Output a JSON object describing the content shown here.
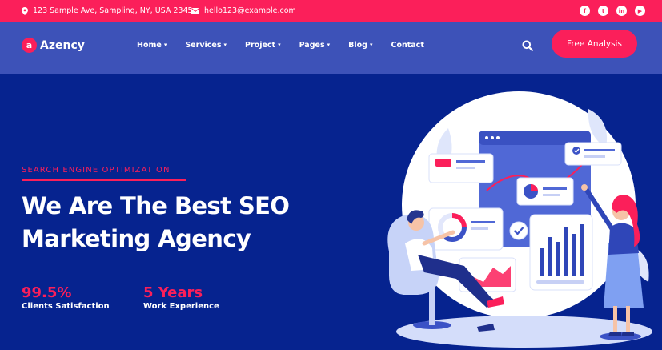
{
  "topbar": {
    "address": "123 Sample Ave, Sampling, NY, USA 2345",
    "email": "hello123@example.com",
    "socials": [
      "facebook",
      "twitter",
      "linkedin",
      "youtube"
    ]
  },
  "brand": {
    "mark": "a",
    "name": "Azency"
  },
  "nav": {
    "items": [
      "Home",
      "Services",
      "Project",
      "Pages",
      "Blog",
      "Contact"
    ],
    "has_dropdown": [
      true,
      true,
      true,
      true,
      true,
      false
    ],
    "cta": "Free Analysis"
  },
  "hero": {
    "eyebrow": "SEARCH ENGINE OPTIMIZATION",
    "headline_line1": "We Are The Best SEO",
    "headline_line2": "Marketing Agency"
  },
  "stats": [
    {
      "value": "99.5%",
      "label": "Clients Satisfaction"
    },
    {
      "value": "5 Years",
      "label": "Work Experience"
    }
  ],
  "colors": {
    "accent": "#fb1f5a",
    "hero_bg": "#06238f",
    "nav_bg": "#3d52b8",
    "text": "#ffffff"
  }
}
